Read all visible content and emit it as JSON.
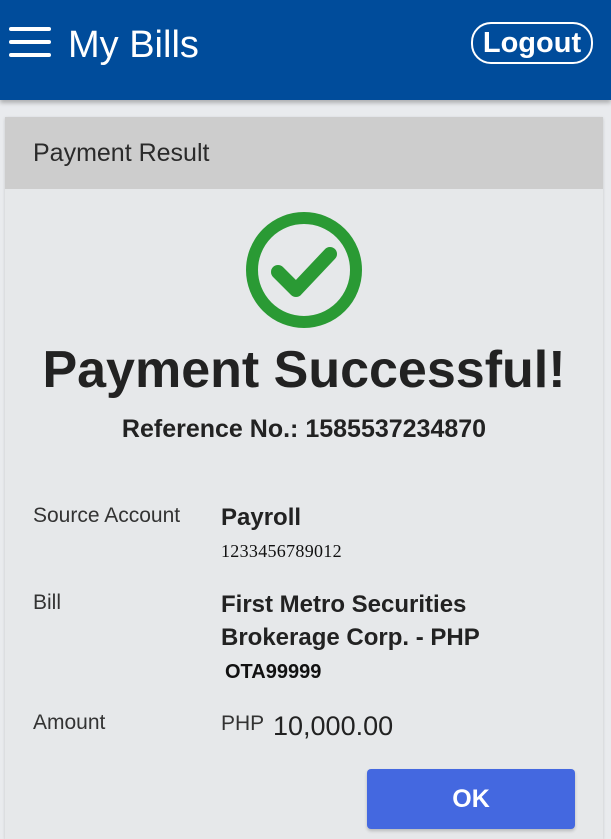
{
  "header": {
    "title": "My Bills",
    "logout_label": "Logout",
    "menu_icon": "hamburger-menu-icon",
    "background_color": "#004c9b"
  },
  "card": {
    "title": "Payment Result",
    "status_icon": "check-circle-icon",
    "status_color": "#2a9a34",
    "heading": "Payment Successful!",
    "reference_label": "Reference No.:",
    "reference_value": "1585537234870",
    "details": {
      "source_account": {
        "label": "Source Account",
        "name": "Payroll",
        "number": "1233456789012"
      },
      "bill": {
        "label": "Bill",
        "biller_line1": "First Metro Securities",
        "biller_line2": "Brokerage Corp. - PHP",
        "account_code": "OTA99999"
      },
      "amount": {
        "label": "Amount",
        "currency": "PHP",
        "value": "10,000.00"
      }
    },
    "ok_label": "OK",
    "ok_color": "#4468e0"
  }
}
